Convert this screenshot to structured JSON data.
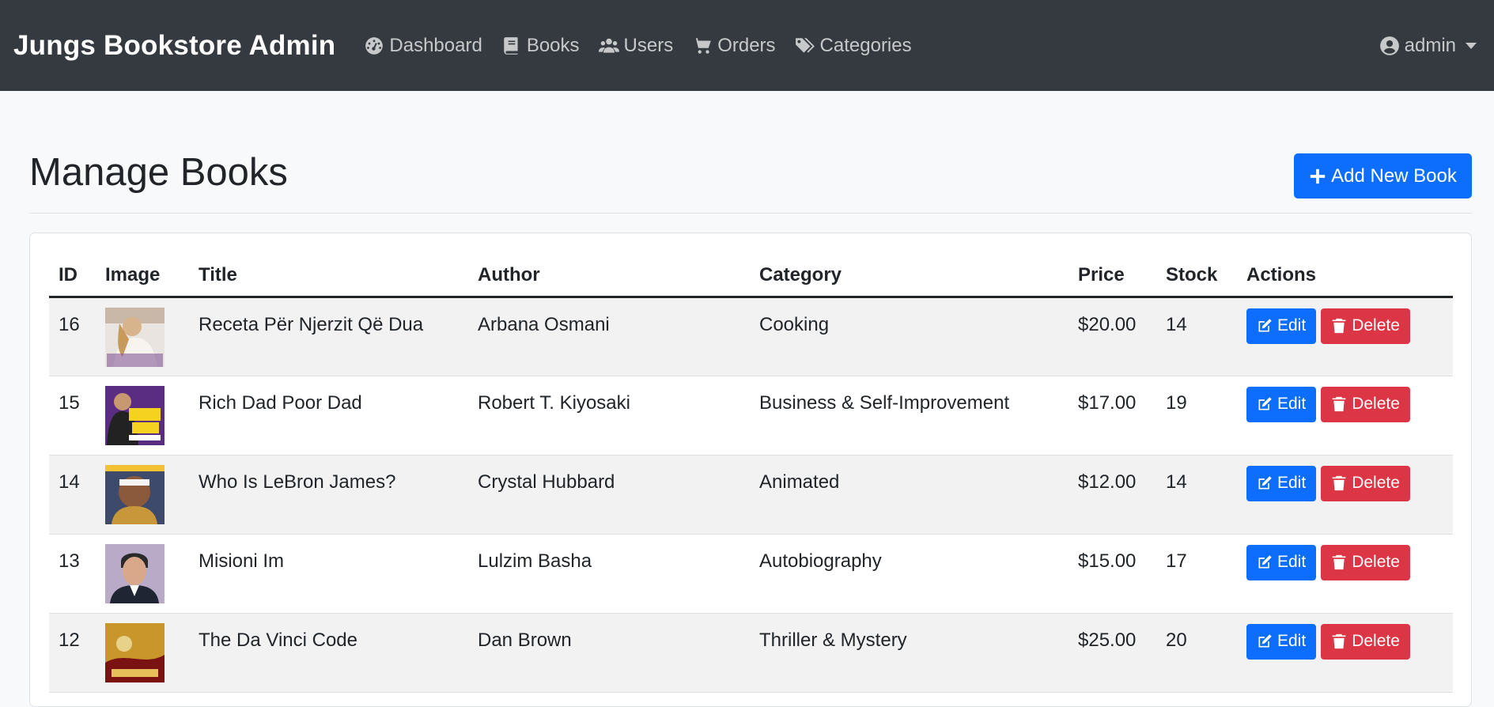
{
  "navbar": {
    "brand": "Jungs Bookstore Admin",
    "items": [
      {
        "label": "Dashboard",
        "icon": "tachometer-icon"
      },
      {
        "label": "Books",
        "icon": "book-icon"
      },
      {
        "label": "Users",
        "icon": "users-icon"
      },
      {
        "label": "Orders",
        "icon": "shopping-cart-icon"
      },
      {
        "label": "Categories",
        "icon": "tags-icon"
      }
    ],
    "user": "admin"
  },
  "header": {
    "title": "Manage Books",
    "add_button": "Add New Book"
  },
  "table": {
    "columns": [
      "ID",
      "Image",
      "Title",
      "Author",
      "Category",
      "Price",
      "Stock",
      "Actions"
    ],
    "rows": [
      {
        "id": "16",
        "title": "Receta Për Njerzit Që Dua",
        "author": "Arbana Osmani",
        "category": "Cooking",
        "price": "$20.00",
        "stock": "14"
      },
      {
        "id": "15",
        "title": "Rich Dad Poor Dad",
        "author": "Robert T. Kiyosaki",
        "category": "Business & Self-Improvement",
        "price": "$17.00",
        "stock": "19"
      },
      {
        "id": "14",
        "title": "Who Is LeBron James?",
        "author": "Crystal Hubbard",
        "category": "Animated",
        "price": "$12.00",
        "stock": "14"
      },
      {
        "id": "13",
        "title": "Misioni Im",
        "author": "Lulzim Basha",
        "category": "Autobiography",
        "price": "$15.00",
        "stock": "17"
      },
      {
        "id": "12",
        "title": "The Da Vinci Code",
        "author": "Dan Brown",
        "category": "Thriller & Mystery",
        "price": "$25.00",
        "stock": "20"
      }
    ],
    "edit_label": "Edit",
    "delete_label": "Delete"
  },
  "colors": {
    "navbar": "#343a40",
    "primary": "#0d6efd",
    "danger": "#dc3545"
  }
}
